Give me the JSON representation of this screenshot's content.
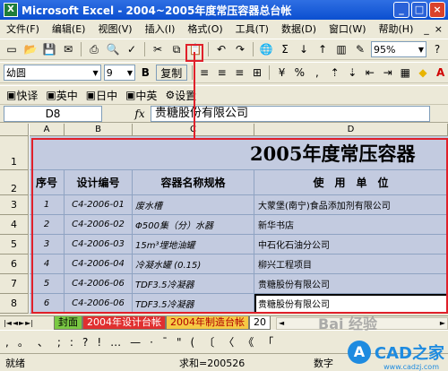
{
  "window": {
    "title": "Microsoft Excel - 2004~2005年度常压容器总台帐",
    "app_icon": "X",
    "min": "_",
    "max": "□",
    "close": "×"
  },
  "menu": {
    "items": [
      "文件(F)",
      "编辑(E)",
      "视图(V)",
      "插入(I)",
      "格式(O)",
      "工具(T)",
      "数据(D)",
      "窗口(W)",
      "帮助(H)"
    ],
    "help_min": "_",
    "help_close": "×"
  },
  "toolbar1": {
    "zoom": "95%"
  },
  "toolbar2": {
    "font": "幼圆",
    "size": "9",
    "bold": "B",
    "copy_label": "复制"
  },
  "toolbar3": {
    "items": [
      "快译",
      "英中",
      "日中",
      "中英",
      "设置"
    ]
  },
  "formula_bar": {
    "cell_ref": "D8",
    "fx": "fx",
    "value": "贵糖股份有限公司"
  },
  "columns": [
    "A",
    "B",
    "C",
    "D"
  ],
  "rows": [
    "1",
    "2",
    "3",
    "4",
    "5",
    "6",
    "7",
    "8"
  ],
  "sheet": {
    "title": "2005年度常压容器",
    "headers": [
      "序号",
      "设计编号",
      "容器名称规格",
      "使　用　单　位"
    ],
    "data": [
      {
        "no": "1",
        "code": "C4-2006-01",
        "name": "废水槽",
        "unit": "大蒙堡(南宁)食品添加剂有限公司"
      },
      {
        "no": "2",
        "code": "C4-2006-02",
        "name": "Φ500集（分）水器",
        "unit": "新华书店"
      },
      {
        "no": "3",
        "code": "C4-2006-03",
        "name": "15m³埋地油罐",
        "unit": "中石化石油分公司"
      },
      {
        "no": "4",
        "code": "C4-2006-04",
        "name": "冷凝水罐 (0.15)",
        "unit": "柳兴工程项目"
      },
      {
        "no": "5",
        "code": "C4-2006-06",
        "name": "TDF3.5冷凝器",
        "unit": "贵糖股份有限公司"
      },
      {
        "no": "6",
        "code": "C4-2006-06",
        "name": "TDF3.5冷凝器",
        "unit": "贵糖股份有限公司"
      }
    ]
  },
  "tabs": {
    "nav": [
      "|◄",
      "◄",
      "►",
      "►|"
    ],
    "items": [
      "封面",
      "2004年设计台帐",
      "2004年制造台帐",
      "20"
    ]
  },
  "status": {
    "left": "就绪",
    "sum": "求和=200526",
    "right": "数字"
  },
  "watermark": {
    "brand": "CAD之家",
    "url": "www.cadzj.com",
    "baidu": "Bai 经验"
  }
}
